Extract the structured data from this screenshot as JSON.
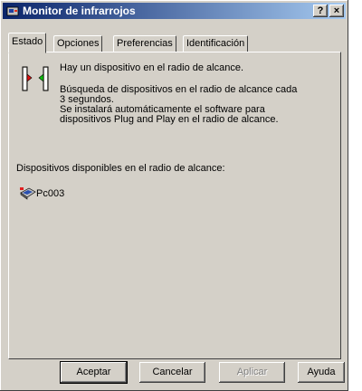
{
  "window": {
    "title": "Monitor de infrarrojos",
    "help_label": "?",
    "close_label": "×"
  },
  "tabs": [
    {
      "label": "Estado",
      "active": true
    },
    {
      "label": "Opciones",
      "active": false
    },
    {
      "label": "Preferencias",
      "active": false
    },
    {
      "label": "Identificación",
      "active": false
    }
  ],
  "status": {
    "line1": "Hay un dispositivo en el radio de alcance.",
    "line2": "Búsqueda de dispositivos en el radio de alcance cada\n3 segundos.",
    "line3": "Se instalará automáticamente el software para\ndispositivos Plug and Play en el radio de alcance."
  },
  "devices": {
    "label": "Dispositivos disponibles en el radio de alcance:",
    "items": [
      {
        "name": "Pc003",
        "icon": "computer-icon"
      }
    ]
  },
  "buttons": {
    "ok": "Aceptar",
    "cancel": "Cancelar",
    "apply": "Aplicar",
    "help": "Ayuda"
  }
}
